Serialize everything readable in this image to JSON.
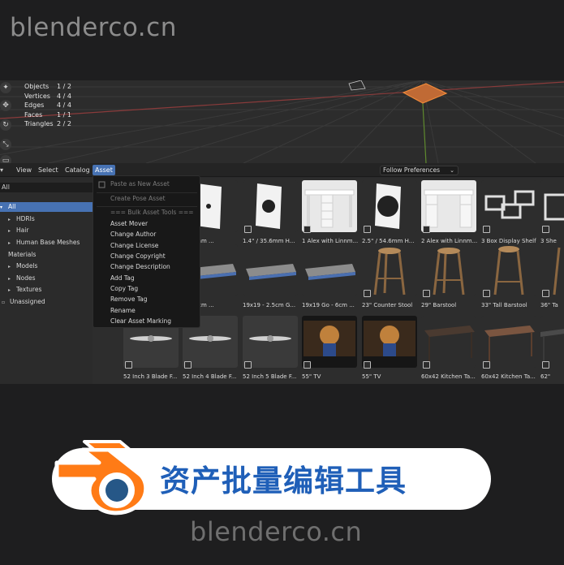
{
  "watermark": {
    "top": "blenderco.cn",
    "bottom": "blenderco.cn"
  },
  "viewport": {
    "stats": [
      {
        "label": "Objects",
        "value": "1 / 2"
      },
      {
        "label": "Vertices",
        "value": "4 / 4"
      },
      {
        "label": "Edges",
        "value": "4 / 4"
      },
      {
        "label": "Faces",
        "value": "1 / 1"
      },
      {
        "label": "Triangles",
        "value": "2 / 2"
      }
    ],
    "colors": {
      "grid": "#3a3a3a",
      "x_axis": "#8a3b3b",
      "y_axis": "#5f8a2e",
      "selection": "#f08a3a"
    }
  },
  "header": {
    "editor_type": "▾",
    "menus": [
      "View",
      "Select",
      "Catalog",
      "Asset"
    ],
    "active_menu": "Asset",
    "library_dropdown": "Follow Preferences"
  },
  "sidebar": {
    "search_value": "All",
    "categories": [
      {
        "label": "All",
        "arrow": "▾",
        "selected": true
      },
      {
        "label": "HDRIs",
        "arrow": "▸"
      },
      {
        "label": "Hair",
        "arrow": "▸"
      },
      {
        "label": "Human Base Meshes",
        "arrow": "▸"
      },
      {
        "label": "Materials",
        "arrow": ""
      },
      {
        "label": "Models",
        "arrow": "▸"
      },
      {
        "label": "Nodes",
        "arrow": "▸"
      },
      {
        "label": "Textures",
        "arrow": "▸"
      },
      {
        "label": "Unassigned",
        "arrow": ""
      }
    ]
  },
  "asset_menu": {
    "items": [
      {
        "label": "Paste as New Asset",
        "dim": true
      },
      {
        "label": "Create Pose Asset",
        "dim": true
      },
      {
        "label": "=== Bulk Asset Tools ===",
        "dim": true
      },
      {
        "label": "Asset Mover"
      },
      {
        "label": "Change Author"
      },
      {
        "label": "Change License"
      },
      {
        "label": "Change Copyright"
      },
      {
        "label": "Change Description"
      },
      {
        "label": "Add Tag"
      },
      {
        "label": "Copy Tag"
      },
      {
        "label": "Remove Tag"
      },
      {
        "label": "Rename"
      },
      {
        "label": "Clear Asset Marking"
      }
    ]
  },
  "assets": {
    "row1": [
      "/ 10.5mm ...",
      "1.4\" / 35.6mm H...",
      "1 Alex with Linnm...",
      "2.5\" / 54.6mm H...",
      "2 Alex with Linnm...",
      "3 Box Display Shelf",
      "3 She"
    ],
    "row2": [
      "Go - 6cm ...",
      "19x19 - 2.5cm G...",
      "19x19 Go - 6cm ...",
      "23\" Counter Stool",
      "29\" Barstool",
      "33\" Tall Barstool",
      "36\" Ta"
    ],
    "row3": [
      "52 Inch 3 Blade F...",
      "52 Inch 4 Blade F...",
      "52 Inch 5 Blade F...",
      "55\" TV",
      "55\" TV",
      "60x42 Kitchen Ta...",
      "60x42 Kitchen Ta...",
      "62\""
    ]
  },
  "banner": {
    "title": "资产批量编辑工具",
    "title_color": "#1f5fb8"
  }
}
